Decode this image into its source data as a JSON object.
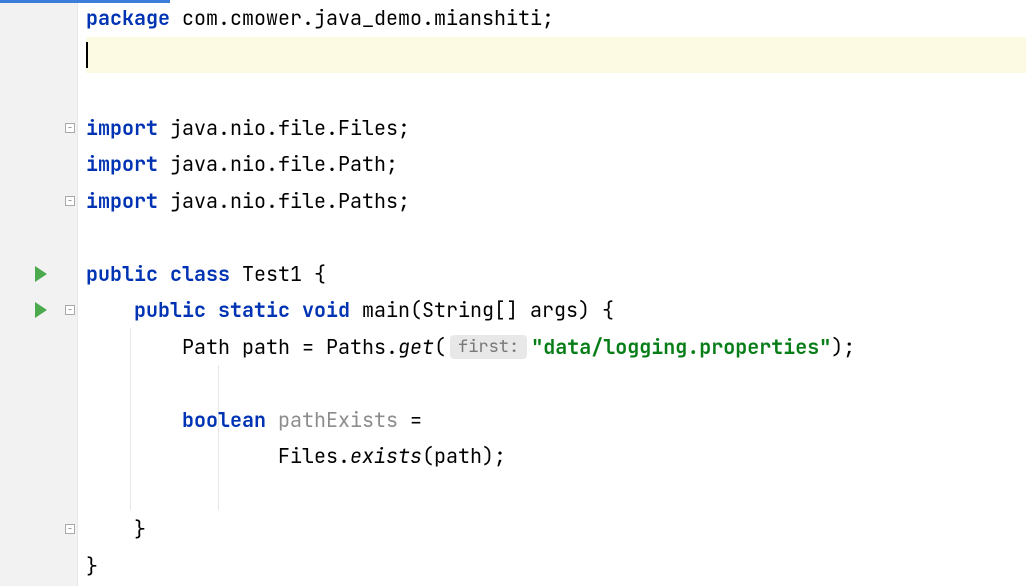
{
  "code": {
    "package_kw": "package",
    "package_name": " com.cmower.java_demo.mianshiti;",
    "import_kw": "import",
    "import1": " java.nio.file.Files;",
    "import2": " java.nio.file.Path;",
    "import3": " java.nio.file.Paths;",
    "public_kw": "public",
    "class_kw": "class",
    "class_name": " Test1 {",
    "static_kw": "static",
    "void_kw": "void",
    "main_sig": " main(String[] args) {",
    "path_decl_pre": "        Path path = Paths.",
    "get_method": "get",
    "paren_open": "(",
    "hint_first": "first:",
    "string_lit": "\"data/logging.properties\"",
    "paren_close_semi": ");",
    "boolean_kw": "boolean",
    "path_exists_var": " pathExists",
    "equals": " =",
    "files_pre": "                Files.",
    "exists_method": "exists",
    "exists_post": "(path);",
    "close_brace_inner": "    }",
    "close_brace_outer": "}",
    "four_sp": "    ",
    "eight_sp": "        "
  }
}
